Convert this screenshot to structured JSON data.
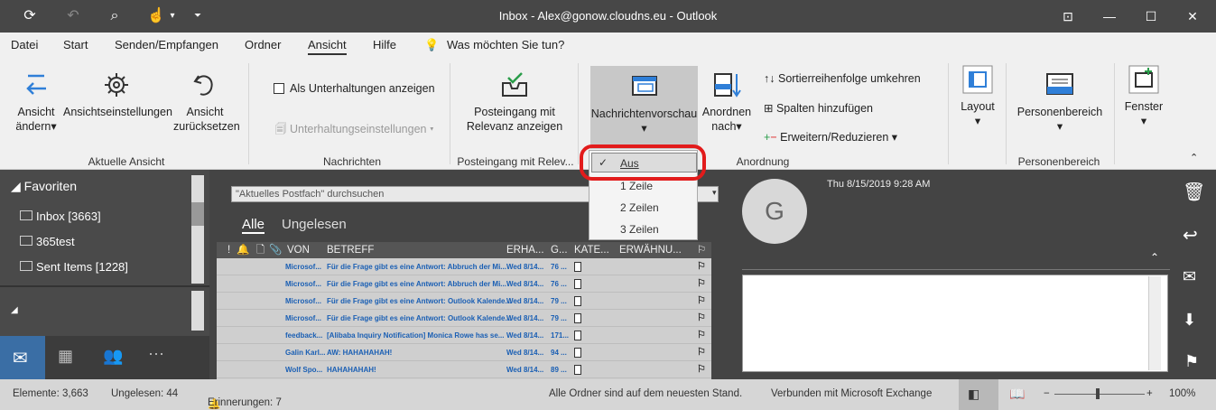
{
  "titlebar": {
    "title": "Inbox - Alex@gonow.cloudns.eu  -  Outlook"
  },
  "tabs": [
    "Datei",
    "Start",
    "Senden/Empfangen",
    "Ordner",
    "Ansicht",
    "Hilfe"
  ],
  "tell_me": "Was möchten Sie tun?",
  "ribbon": {
    "ansicht_aendern": "Ansicht",
    "ansicht_aendern2": "ändern",
    "ansichtseinstellungen": "Ansichtseinstellungen",
    "ansicht_zuruecksetzen": "Ansicht",
    "ansicht_zuruecksetzen2": "zurücksetzen",
    "group_aktuelle_ansicht": "Aktuelle Ansicht",
    "als_unterhaltungen": "Als Unterhaltungen anzeigen",
    "unterhaltungseinstellungen": "Unterhaltungseinstellungen",
    "group_nachrichten": "Nachrichten",
    "posteingang_relevanz": "Posteingang mit",
    "posteingang_relevanz2": "Relevanz anzeigen",
    "group_posteingang": "Posteingang mit Relev...",
    "nachrichtenvorschau": "Nachrichtenvorschau",
    "anordnen": "Anordnen",
    "anordnen2": "nach",
    "sortierreihenfolge": "Sortierreihenfolge umkehren",
    "spalten": "Spalten hinzufügen",
    "erweitern": "Erweitern/Reduzieren",
    "group_anordnung": "Anordnung",
    "layout": "Layout",
    "personenbereich": "Personenbereich",
    "group_personenbereich": "Personenbereich",
    "fenster": "Fenster"
  },
  "dropdown": {
    "items": [
      "Aus",
      "1 Zeile",
      "2 Zeilen",
      "3 Zeilen"
    ],
    "checked": "Aus"
  },
  "nav": {
    "favoriten": "Favoriten",
    "folders": [
      "Inbox [3663]",
      "365test",
      "Sent Items [1228]"
    ]
  },
  "list": {
    "search_placeholder": "\"Aktuelles Postfach\" durchsuchen",
    "tab_all": "Alle",
    "tab_unread": "Ungelesen",
    "columns": [
      "VON",
      "BETREFF",
      "ERHA...",
      "G...",
      "KATE...",
      "ERWÄHNU..."
    ],
    "rows": [
      {
        "from": "Microsof...",
        "subject": "Für die Frage gibt es eine Antwort: Abbruch der Mi...",
        "date": "Wed 8/14...",
        "size": "76 ..."
      },
      {
        "from": "Microsof...",
        "subject": "Für die Frage gibt es eine Antwort: Abbruch der Mi...",
        "date": "Wed 8/14...",
        "size": "76 ..."
      },
      {
        "from": "Microsof...",
        "subject": "Für die Frage gibt es eine Antwort: Outlook Kalende...",
        "date": "Wed 8/14...",
        "size": "79 ..."
      },
      {
        "from": "Microsof...",
        "subject": "Für die Frage gibt es eine Antwort: Outlook Kalende...",
        "date": "Wed 8/14...",
        "size": "79 ..."
      },
      {
        "from": "feedback...",
        "subject": "[Alibaba Inquiry Notification] Monica Rowe has se...",
        "date": "Wed 8/14...",
        "size": "171..."
      },
      {
        "from": "Galin Karl...",
        "subject": "AW: HAHAHAHAH!",
        "date": "Wed 8/14...",
        "size": "94 ..."
      },
      {
        "from": "Wolf Spo...",
        "subject": "HAHAHAHAH!",
        "date": "Wed 8/14...",
        "size": "89 ..."
      }
    ]
  },
  "reading": {
    "avatar": "G",
    "date": "Thu 8/15/2019 9:28 AM"
  },
  "status": {
    "elemente": "Elemente: 3,663",
    "ungelesen": "Ungelesen: 44",
    "erinnerungen": "Erinnerungen: 7",
    "ordner": "Alle Ordner sind auf dem neuesten Stand.",
    "verbunden": "Verbunden mit Microsoft Exchange",
    "zoom": "100%"
  }
}
